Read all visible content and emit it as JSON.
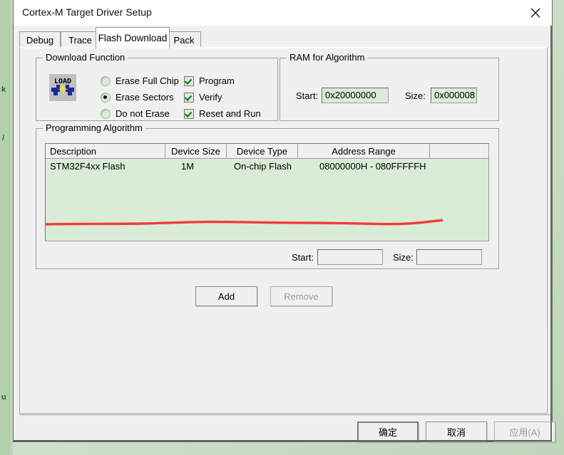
{
  "window": {
    "title": "Cortex-M Target Driver Setup",
    "close_icon": "close-icon"
  },
  "tabs": [
    {
      "label": "Debug",
      "active": false
    },
    {
      "label": "Trace",
      "active": false
    },
    {
      "label": "Flash Download",
      "active": true
    },
    {
      "label": "Pack",
      "active": false
    }
  ],
  "download_function": {
    "legend": "Download Function",
    "icon_text": "LOAD",
    "radios": [
      {
        "label": "Erase Full Chip",
        "checked": false
      },
      {
        "label": "Erase Sectors",
        "checked": true
      },
      {
        "label": "Do not Erase",
        "checked": false
      }
    ],
    "checkboxes": [
      {
        "label": "Program",
        "checked": true
      },
      {
        "label": "Verify",
        "checked": true
      },
      {
        "label": "Reset and Run",
        "checked": true
      }
    ]
  },
  "ram_for_algorithm": {
    "legend": "RAM for Algorithm",
    "start_label": "Start:",
    "start_value": "0x20000000",
    "size_label": "Size:",
    "size_value": "0x000008"
  },
  "programming_algorithm": {
    "legend": "Programming Algorithm",
    "columns": [
      "Description",
      "Device Size",
      "Device Type",
      "Address Range",
      ""
    ],
    "rows": [
      {
        "description": "STM32F4xx Flash",
        "device_size": "1M",
        "device_type": "On-chip Flash",
        "address_range": "08000000H - 080FFFFFH"
      }
    ],
    "start_label": "Start:",
    "start_value": "",
    "size_label": "Size:",
    "size_value": "",
    "add_label": "Add",
    "remove_label": "Remove"
  },
  "footer": {
    "ok_label": "确定",
    "cancel_label": "取消",
    "apply_label": "应用(A)"
  },
  "annotation": {
    "type": "red-underline",
    "color": "#f23b3b"
  }
}
